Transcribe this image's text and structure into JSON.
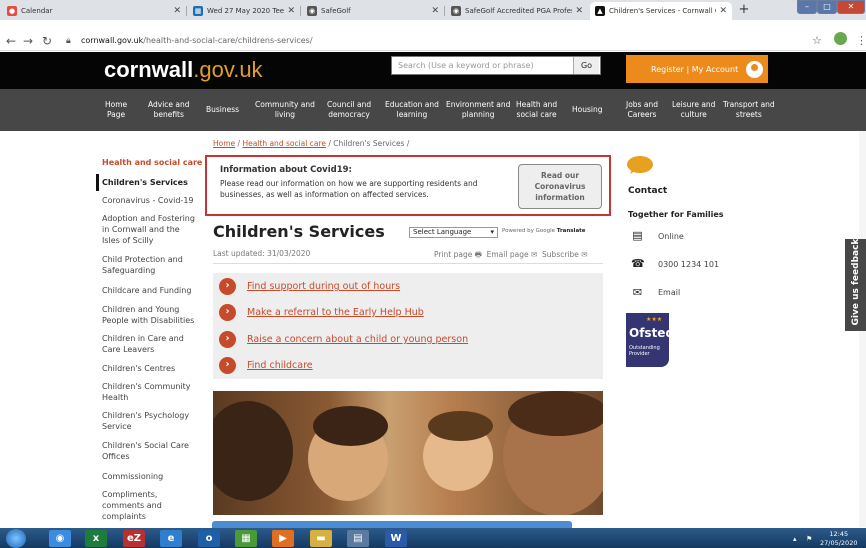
{
  "browser": {
    "tabs": [
      {
        "title": "Calendar",
        "icon": "calendar-icon",
        "color": "#e84c3d"
      },
      {
        "title": "Wed 27 May 2020 Tee Booking S",
        "icon": "booking-icon",
        "color": "#1a6fb5"
      },
      {
        "title": "SafeGolf",
        "icon": "globe-icon",
        "color": "#555555"
      },
      {
        "title": "SafeGolf Accredited PGA Profess",
        "icon": "globe-icon",
        "color": "#555555"
      },
      {
        "title": "Children's Services - Cornwall Co",
        "icon": "cornwall-icon",
        "color": "#111111"
      }
    ],
    "new_tab": "+",
    "url_domain": "cornwall.gov.uk",
    "url_path": "/health-and-social-care/childrens-services/"
  },
  "site": {
    "logo_main": "cornwall",
    "logo_gov": ".gov.uk",
    "search_placeholder": "Search (Use a keyword or phrase)",
    "go": "Go",
    "account": "Register | My Account",
    "accent": "#ec8a1b",
    "nav": [
      [
        "Home",
        "Page"
      ],
      [
        "Advice and",
        "benefits"
      ],
      [
        "Business",
        ""
      ],
      [
        "Community and",
        "living"
      ],
      [
        "Council and",
        "democracy"
      ],
      [
        "Education and",
        "learning"
      ],
      [
        "Environment and",
        "planning"
      ],
      [
        "Health and",
        "social care"
      ],
      [
        "Housing",
        ""
      ],
      [
        "Jobs and",
        "Careers"
      ],
      [
        "Leisure and",
        "culture"
      ],
      [
        "Transport and",
        "streets"
      ]
    ]
  },
  "breadcrumb": {
    "home": "Home",
    "sep1": " / ",
    "health": "Health and social care",
    "sep2": " / ",
    "current": "Children's Services /"
  },
  "sidebar": {
    "heading": "Health and social care",
    "items": [
      [
        "Children's Services"
      ],
      [
        "Coronavirus - Covid-19"
      ],
      [
        "Adoption and Fostering",
        "in Cornwall and the",
        "Isles of Scilly"
      ],
      [
        "Child Protection and",
        "Safeguarding"
      ],
      [
        "Childcare and Funding"
      ],
      [
        "Children and Young",
        "People with Disabilities"
      ],
      [
        "Children in Care and",
        "Care Leavers"
      ],
      [
        "Children's Centres"
      ],
      [
        "Children's Community",
        "Health"
      ],
      [
        "Children's Psychology",
        "Service"
      ],
      [
        "Children's Social Care",
        "Offices"
      ],
      [
        "Commissioning"
      ],
      [
        "Compliments,",
        "comments and",
        "complaints"
      ]
    ]
  },
  "alert": {
    "title": "Information about Covid19:",
    "body": "Please read our information on how we are supporting residents and businesses, as well as information on affected services.",
    "button": [
      "Read our",
      "Coronavirus",
      "information"
    ]
  },
  "main": {
    "title": "Children's Services",
    "language": "Select Language",
    "powered_by": "Powered by ",
    "google": "Google",
    "translate": "Translate",
    "updated": "Last updated: 31/03/2020",
    "print": "Print page",
    "email": "Email page",
    "subscribe": "Subscribe",
    "links": [
      "Find support during out of hours",
      "Make a referral to the Early Help Hub",
      "Raise a concern about a child or young person",
      "Find childcare"
    ]
  },
  "contact": {
    "heading": "Contact",
    "org": "Together for Families",
    "rows": [
      {
        "icon": "online-icon",
        "text": "Online"
      },
      {
        "icon": "phone-icon",
        "text": "0300 1234 101"
      },
      {
        "icon": "email-icon",
        "text": "Email"
      }
    ],
    "ofsted": "Ofsted",
    "ofsted_sub": [
      "Outstanding",
      "Provider"
    ]
  },
  "feedback": "Give us feedback",
  "taskbar": {
    "time": "12:45",
    "date": "27/05/2020"
  }
}
